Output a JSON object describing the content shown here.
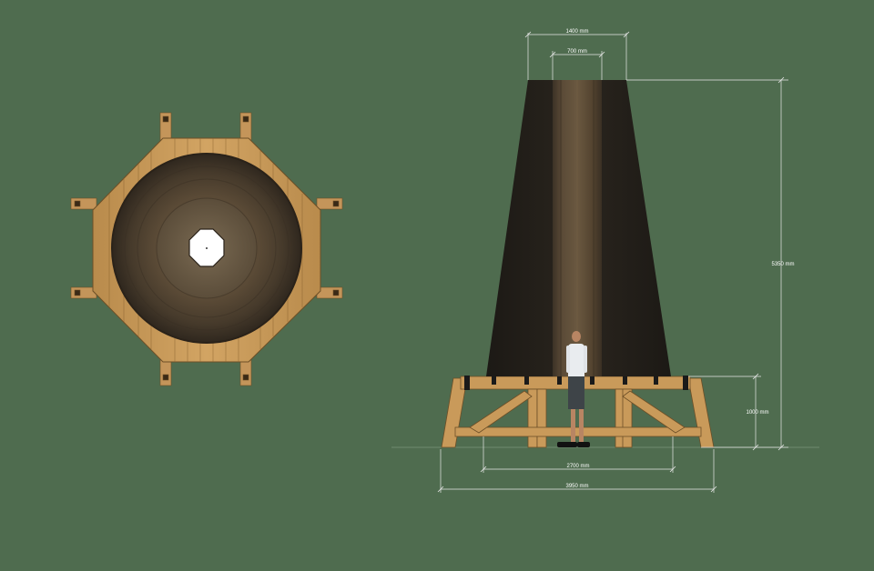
{
  "colors": {
    "background": "#4f6c4f",
    "timber": "#c99a5a",
    "timber_dark": "#8a6430",
    "earth_dark": "#231f1a",
    "earth_mid": "#4a3d2d",
    "dimension_line": "#e8e8e8"
  },
  "dimensions": {
    "top_width": "1400 mm",
    "top_inner": "700 mm",
    "total_height": "5350 mm",
    "base_height": "1000 mm",
    "inner_span": "2700 mm",
    "base_width": "3950 mm"
  }
}
